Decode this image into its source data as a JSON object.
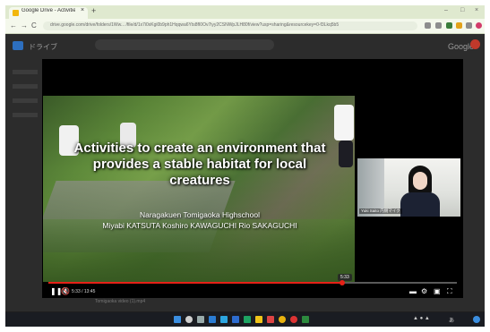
{
  "browser": {
    "tab_title": "Google Drive - Activities (MP4)",
    "tab_close": "×",
    "new_tab": "+",
    "url": "drive.google.com/drive/folders/1Ww...  /file/d/1x7i0xKgi0b9ph1Hqqwa6Yts8fI0Ov7iyy2CSNWpJLH80f/view?usp=sharing&resourcekey=0-f3Lkq5b5",
    "nav_back": "←",
    "nav_forward": "→",
    "nav_reload": "C",
    "win_min": "–",
    "win_max": "□",
    "win_close": "×"
  },
  "drive": {
    "title": "ドライブ",
    "google": "Google",
    "list_row": "Tomigaoka video (1).mp4"
  },
  "video": {
    "title": "Activities to create an environment that provides a stable habitat for local creatures",
    "school": "Naragakuen Tomigaoka Highschool",
    "authors": "Miyabi KATSUTA  Koshiro KAWAGUCHI  Rio SAKAGUCHI",
    "cam_label": "Yuki Saito 内側マイク",
    "progress_fraction": 0.72,
    "tooltip_time": "5:33",
    "time_display": "5:33 / 13:45"
  },
  "colors": {
    "progress": "#e62117",
    "tabbar": "#dfe9cf"
  }
}
